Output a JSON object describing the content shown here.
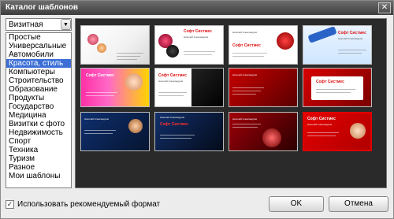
{
  "window": {
    "title": "Каталог шаблонов"
  },
  "category_select": {
    "value": "Визитная"
  },
  "categories": [
    "Простые",
    "Универсальные",
    "Автомобили",
    "Красота, стиль",
    "Компьютеры",
    "Строительство",
    "Образование",
    "Продукты",
    "Государство",
    "Медицина",
    "Визитки с фото",
    "Недвижимость",
    "Спорт",
    "Техника",
    "Туризм",
    "Разное",
    "Мои шаблоны"
  ],
  "selected_category": "Красота, стиль",
  "templates": {
    "brand": "Софт Систмес",
    "name": "Николай Александров",
    "position": "Менеджер по продажам",
    "phone": "т. (495) 123-45-67, (812) 765-43-21",
    "email": "info@softsistmes.ru",
    "address": "г. Москва, ул. Ленина, д. 15"
  },
  "footer": {
    "checkbox_label": "Использовать рекомендуемый формат",
    "checkbox_checked": true,
    "ok_label": "OK",
    "cancel_label": "Отмена"
  },
  "colors": {
    "selection": "#3b6fd6",
    "card_selected_border": "#e00000",
    "brand_text": "#e01010"
  }
}
